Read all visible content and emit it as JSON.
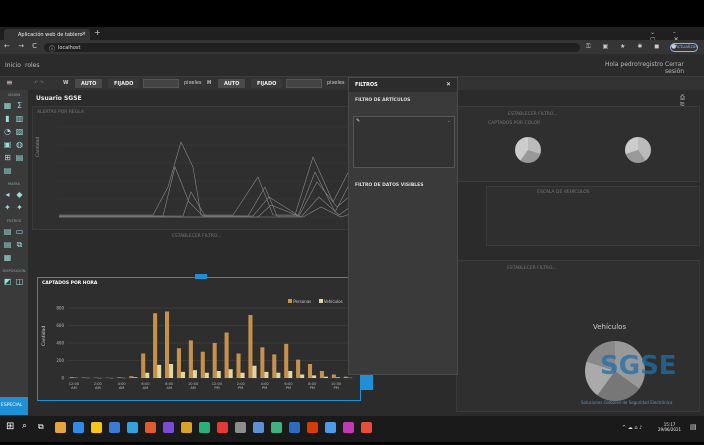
{
  "browser": {
    "tab_title": "Aplicación web de tablero",
    "url": "localhost",
    "update_label": "Actualizar"
  },
  "menu": {
    "home": "Inicio",
    "roles": "roles",
    "request": "Hola pedro!",
    "register": "registro",
    "logout": "Cerrar sesión"
  },
  "toolbar": {
    "width_label": "W",
    "height_label": "H",
    "auto": "AUTO",
    "fixed": "FIJADO",
    "units": "pixeles"
  },
  "sidebar": {
    "section_1": "VISION",
    "section_2": "MAPAS",
    "section_3": "FILTROS",
    "section_4": "DISPOSICIÓN",
    "special": "ESPECIAL"
  },
  "dashboard": {
    "title": "Usuario SGSE"
  },
  "cards": {
    "line": {
      "title": "ALERTAS POR REGLA",
      "ylabel": "Cantidad"
    },
    "pie": {
      "title": "ESTABLECER FILTRO...",
      "subtitle": "CAPTADOS POR COLOR"
    },
    "hours": {
      "title": "ESCALA DE VEHÍCULOS"
    },
    "vehicles": {
      "title": "ESTABLECER FILTRO...",
      "heading": "Vehículos"
    },
    "bar_prompt": "ESTABLECER FILTRO..."
  },
  "filters": {
    "title": "FILTROS",
    "articles_label": "FILTRO DE ARTÍCULOS",
    "visible_label": "FILTRO DE DATOS VISIBLES"
  },
  "brand": {
    "logo": "SGSE",
    "tagline": "Soluciones Globales de Seguridad Electrónica"
  },
  "taskbar": {
    "time": "15:17",
    "date": "29/06/2021"
  },
  "chart_data": {
    "type": "bar",
    "title": "CAPTADOS POR HORA",
    "xlabel": "",
    "ylabel": "Cantidad",
    "ylim": [
      0,
      800
    ],
    "yticks": [
      0,
      200,
      400,
      600,
      800
    ],
    "categories": [
      "12:00 AM",
      "1:00 AM",
      "2:00 AM",
      "3:00 AM",
      "4:00 AM",
      "5:00 AM",
      "6:00 AM",
      "7:00 AM",
      "8:00 AM",
      "9:00 AM",
      "10:00 AM",
      "11:00 AM",
      "12:00 PM",
      "1:00 PM",
      "2:00 PM",
      "3:00 PM",
      "4:00 PM",
      "5:00 PM",
      "6:00 PM",
      "7:00 PM",
      "8:00 PM",
      "9:00 PM",
      "10:00 PM",
      "11:00 PM"
    ],
    "xtick_labels": [
      "12:00 AM",
      "",
      "2:00 AM",
      "",
      "4:00 AM",
      "",
      "6:00 AM",
      "",
      "8:00 AM",
      "",
      "10:00 AM",
      "",
      "12:00 PM",
      "",
      "2:00 PM",
      "",
      "4:00 PM",
      "",
      "6:00 PM",
      "",
      "8:00 PM",
      "",
      "10:00 PM",
      ""
    ],
    "series": [
      {
        "name": "Personas",
        "color": "#c8914b",
        "values": [
          10,
          5,
          4,
          3,
          8,
          20,
          280,
          740,
          760,
          340,
          430,
          300,
          400,
          520,
          280,
          720,
          350,
          270,
          390,
          210,
          160,
          80,
          40,
          15
        ]
      },
      {
        "name": "Vehículos",
        "color": "#e0d7a3",
        "values": [
          3,
          2,
          1,
          1,
          2,
          8,
          60,
          150,
          160,
          70,
          90,
          60,
          80,
          100,
          60,
          140,
          70,
          60,
          80,
          40,
          30,
          15,
          8,
          3
        ]
      }
    ]
  }
}
